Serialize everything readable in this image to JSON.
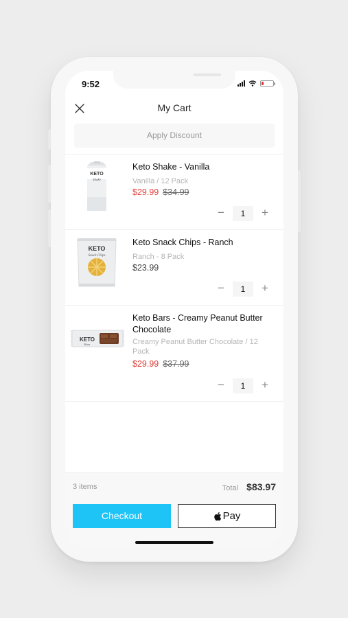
{
  "status": {
    "time": "9:52",
    "battery_color": "#e03131",
    "battery_level": 0.18
  },
  "header": {
    "title": "My Cart",
    "close_icon": "close-icon"
  },
  "discount": {
    "label": "Apply Discount"
  },
  "items": [
    {
      "name": "Keto Shake - Vanilla",
      "variant": "Vanilla / 12 Pack",
      "price": "$29.99",
      "old_price": "$34.99",
      "on_sale": true,
      "quantity": "1"
    },
    {
      "name": "Keto Snack Chips - Ranch",
      "variant": "Ranch - 8 Pack",
      "price": "$23.99",
      "old_price": "",
      "on_sale": false,
      "quantity": "1"
    },
    {
      "name": "Keto Bars - Creamy Peanut Butter Chocolate",
      "variant": "Creamy Peanut Butter Chocolate / 12 Pack",
      "price": "$29.99",
      "old_price": "$37.99",
      "on_sale": true,
      "quantity": "1"
    }
  ],
  "product_labels": {
    "brand": "KETO",
    "shake_sub": "Shake",
    "chips_sub": "Snack Chips",
    "bars_sub": "Bars"
  },
  "qty_controls": {
    "minus": "−",
    "plus": "+"
  },
  "footer": {
    "count": "3 items",
    "total_label": "Total",
    "total_value": "$83.97",
    "checkout_label": "Checkout",
    "applepay_label": "Pay",
    "accent_color": "#1ec4f6",
    "sale_color": "#e0403a"
  }
}
